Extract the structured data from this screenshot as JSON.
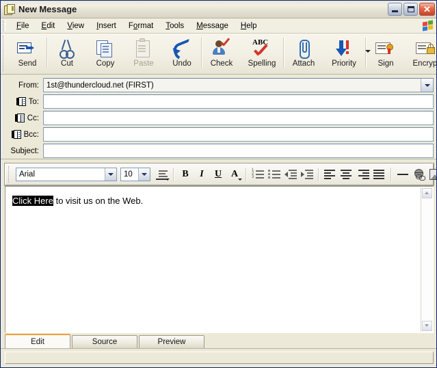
{
  "window": {
    "title": "New Message",
    "icon": "message-document-icon",
    "buttons": {
      "minimize": "minimize-button",
      "maximize": "maximize-button",
      "close": "close-button"
    }
  },
  "menubar": {
    "items": [
      {
        "label": "File",
        "accel": "F"
      },
      {
        "label": "Edit",
        "accel": "E"
      },
      {
        "label": "View",
        "accel": "V"
      },
      {
        "label": "Insert",
        "accel": "I"
      },
      {
        "label": "Format",
        "accel": "o"
      },
      {
        "label": "Tools",
        "accel": "T"
      },
      {
        "label": "Message",
        "accel": "M"
      },
      {
        "label": "Help",
        "accel": "H"
      }
    ],
    "logo": "windows-logo-icon"
  },
  "toolbar": {
    "overflow": "»",
    "buttons": [
      {
        "label": "Send",
        "icon": "send-icon",
        "enabled": true
      },
      {
        "label": "Cut",
        "icon": "cut-icon",
        "enabled": true
      },
      {
        "label": "Copy",
        "icon": "copy-icon",
        "enabled": true
      },
      {
        "label": "Paste",
        "icon": "paste-icon",
        "enabled": false
      },
      {
        "label": "Undo",
        "icon": "undo-icon",
        "enabled": true
      },
      {
        "label": "Check",
        "icon": "check-names-icon",
        "enabled": true
      },
      {
        "label": "Spelling",
        "icon": "spelling-icon",
        "enabled": true
      },
      {
        "label": "Attach",
        "icon": "attach-icon",
        "enabled": true
      },
      {
        "label": "Priority",
        "icon": "priority-icon",
        "enabled": true,
        "has_dropdown": true
      },
      {
        "label": "Sign",
        "icon": "sign-icon",
        "enabled": true
      },
      {
        "label": "Encrypt",
        "icon": "encrypt-icon",
        "enabled": true
      }
    ]
  },
  "headers": {
    "from": {
      "label": "From:",
      "value": "1st@thundercloud.net   (FIRST)",
      "has_dropdown": true
    },
    "to": {
      "label": "To:",
      "value": "",
      "icon": "address-book-icon"
    },
    "cc": {
      "label": "Cc:",
      "value": "",
      "icon": "address-book-icon"
    },
    "bcc": {
      "label": "Bcc:",
      "value": "",
      "icon": "address-book-icon"
    },
    "subject": {
      "label": "Subject:",
      "value": ""
    }
  },
  "format_toolbar": {
    "font": {
      "value": "Arial"
    },
    "size": {
      "value": "10"
    },
    "buttons": [
      {
        "name": "paragraph-style-button",
        "label": "≡"
      },
      {
        "name": "bold-button",
        "label": "B"
      },
      {
        "name": "italic-button",
        "label": "I"
      },
      {
        "name": "underline-button",
        "label": "U"
      },
      {
        "name": "font-color-button",
        "label": "A"
      },
      {
        "name": "numbered-list-button",
        "label": ""
      },
      {
        "name": "bulleted-list-button",
        "label": ""
      },
      {
        "name": "decrease-indent-button",
        "label": ""
      },
      {
        "name": "increase-indent-button",
        "label": ""
      },
      {
        "name": "align-left-button",
        "label": ""
      },
      {
        "name": "align-center-button",
        "label": ""
      },
      {
        "name": "align-right-button",
        "label": ""
      },
      {
        "name": "justify-button",
        "label": ""
      },
      {
        "name": "horizontal-rule-button",
        "label": ""
      },
      {
        "name": "insert-link-button",
        "label": ""
      },
      {
        "name": "insert-image-button",
        "label": ""
      }
    ]
  },
  "body": {
    "selected_text": "Click Here",
    "rest_text": " to visit us on the Web."
  },
  "tabs": [
    {
      "label": "Edit",
      "active": true
    },
    {
      "label": "Source",
      "active": false
    },
    {
      "label": "Preview",
      "active": false
    }
  ],
  "colors": {
    "accent_orange": "#f0a23c",
    "face": "#ece9d8",
    "field_border": "#7f9db9",
    "icon_blue": "#1757b5",
    "icon_red": "#d4342a"
  }
}
